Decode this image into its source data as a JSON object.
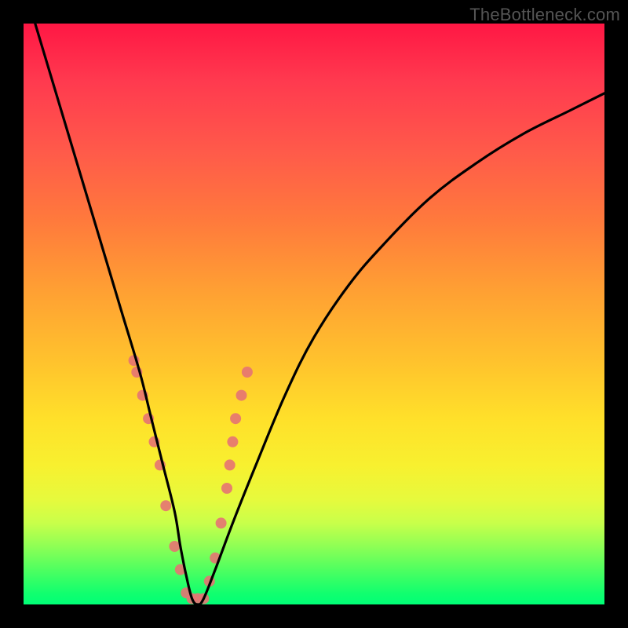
{
  "watermark": "TheBottleneck.com",
  "chart_data": {
    "type": "line",
    "title": "",
    "xlabel": "",
    "ylabel": "",
    "xlim": [
      0,
      100
    ],
    "ylim": [
      0,
      100
    ],
    "background": {
      "kind": "vertical-gradient",
      "stops": [
        {
          "pos": 0,
          "color": "#ff1744"
        },
        {
          "pos": 50,
          "color": "#ffc22d"
        },
        {
          "pos": 80,
          "color": "#f8f02f"
        },
        {
          "pos": 100,
          "color": "#00ff76"
        }
      ]
    },
    "series": [
      {
        "name": "bottleneck-curve",
        "color": "#000000",
        "x": [
          2,
          5,
          8,
          11,
          14,
          17,
          20,
          22,
          24,
          26,
          27,
          28,
          29,
          30,
          31,
          33,
          36,
          40,
          45,
          50,
          56,
          62,
          70,
          78,
          86,
          94,
          100
        ],
        "y": [
          100,
          90,
          80,
          70,
          60,
          50,
          40,
          32,
          24,
          16,
          10,
          5,
          1,
          0,
          1,
          6,
          14,
          24,
          36,
          46,
          55,
          62,
          70,
          76,
          81,
          85,
          88
        ]
      }
    ],
    "markers": {
      "name": "highlight-points",
      "color": "#e57373",
      "radius_px": 7,
      "x": [
        19.0,
        19.5,
        20.5,
        21.5,
        22.5,
        23.5,
        24.5,
        26.0,
        27.0,
        28.0,
        29.0,
        30.0,
        31.0,
        32.0,
        33.0,
        34.0,
        35.0,
        35.5,
        36.0,
        36.5,
        37.5,
        38.5
      ],
      "y": [
        42.0,
        40.0,
        36.0,
        32.0,
        28.0,
        24.0,
        17.0,
        10.0,
        6.0,
        2.0,
        1.0,
        1.0,
        1.0,
        4.0,
        8.0,
        14.0,
        20.0,
        24.0,
        28.0,
        32.0,
        36.0,
        40.0
      ]
    }
  }
}
